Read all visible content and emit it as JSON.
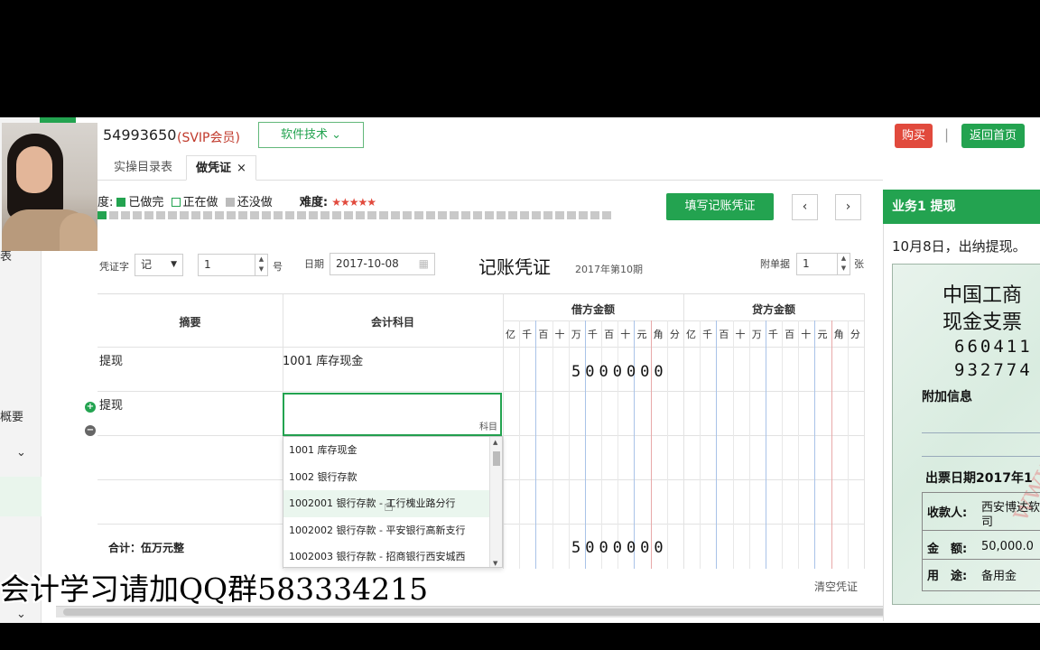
{
  "header": {
    "account_id": "54993650",
    "member_badge": "(SVIP会员)",
    "tech_button": "软件技术 ⌄",
    "buy_button": "购买",
    "separator": "|",
    "home_button": "返回首页"
  },
  "sidebar": {
    "fragment_top": "表",
    "fragment_mid": "概要",
    "chevron": "⌄"
  },
  "tabs": [
    {
      "label": "实操目录表"
    },
    {
      "label": "做凭证",
      "close": "×"
    }
  ],
  "progress": {
    "label": "度:",
    "done_label": "已做完",
    "doing_label": "正在做",
    "todo_label": "还没做",
    "difficulty_label": "难度:",
    "difficulty_stars": "★★★★★",
    "total_tasks": 44,
    "completed_tasks": 1
  },
  "toolbar": {
    "fill_voucher_button": "填写记账凭证",
    "prev": "‹",
    "next": "›"
  },
  "voucher": {
    "word_label": "凭证字",
    "word_value": "记",
    "word_arrow": "▼",
    "number_value": "1",
    "number_suffix": "号",
    "date_label": "日期",
    "date_value": "2017-10-08",
    "title": "记账凭证",
    "period": "2017年第10期",
    "attachments_label": "附单据",
    "attachments_value": "1",
    "attachments_suffix": "张",
    "columns": {
      "summary": "摘要",
      "account": "会计科目",
      "debit": "借方金额",
      "credit": "贷方金额",
      "digits": [
        "亿",
        "千",
        "百",
        "十",
        "万",
        "千",
        "百",
        "十",
        "元",
        "角",
        "分"
      ]
    },
    "rows": [
      {
        "summary": "提现",
        "account": "1001 库存现金",
        "debit": "5000000",
        "credit": ""
      },
      {
        "summary": "提现",
        "account": "",
        "debit": "",
        "credit": ""
      }
    ],
    "active_input_hint": "科目",
    "total_label": "合计：伍万元整",
    "total_debit": "5000000",
    "clear_button": "清空凭证"
  },
  "account_dropdown": {
    "options": [
      "1001 库存现金",
      "1002 银行存款",
      "1002001 银行存款 - 工行槐业路分行",
      "1002002 银行存款 - 平安银行高新支行",
      "1002003 银行存款 - 招商银行西安城西"
    ],
    "highlighted_index": 2
  },
  "overlay": {
    "watermark_text": "会计学习请加QQ群583334215"
  },
  "task_panel": {
    "title": "业务1 提现",
    "description": "10月8日，出纳提现。",
    "cheque": {
      "bank_line1": "中国工商",
      "bank_line2": "现金支票",
      "number_line1": "660411",
      "number_line2": "932774",
      "extra_info_label": "附加信息",
      "issue_date": "出票日期2017年1",
      "payee_label": "收款人:",
      "payee_value_line1": "西安博达软",
      "payee_value_line2": "司",
      "amount_label": "金　额:",
      "amount_value": "50,000.0",
      "purpose_label": "用　途:",
      "purpose_value": "备用金",
      "watermark": "www.acc5.c"
    }
  },
  "colors": {
    "brand_green": "#23a350",
    "buy_red": "#e14a3d",
    "member_red": "#c0392b"
  }
}
